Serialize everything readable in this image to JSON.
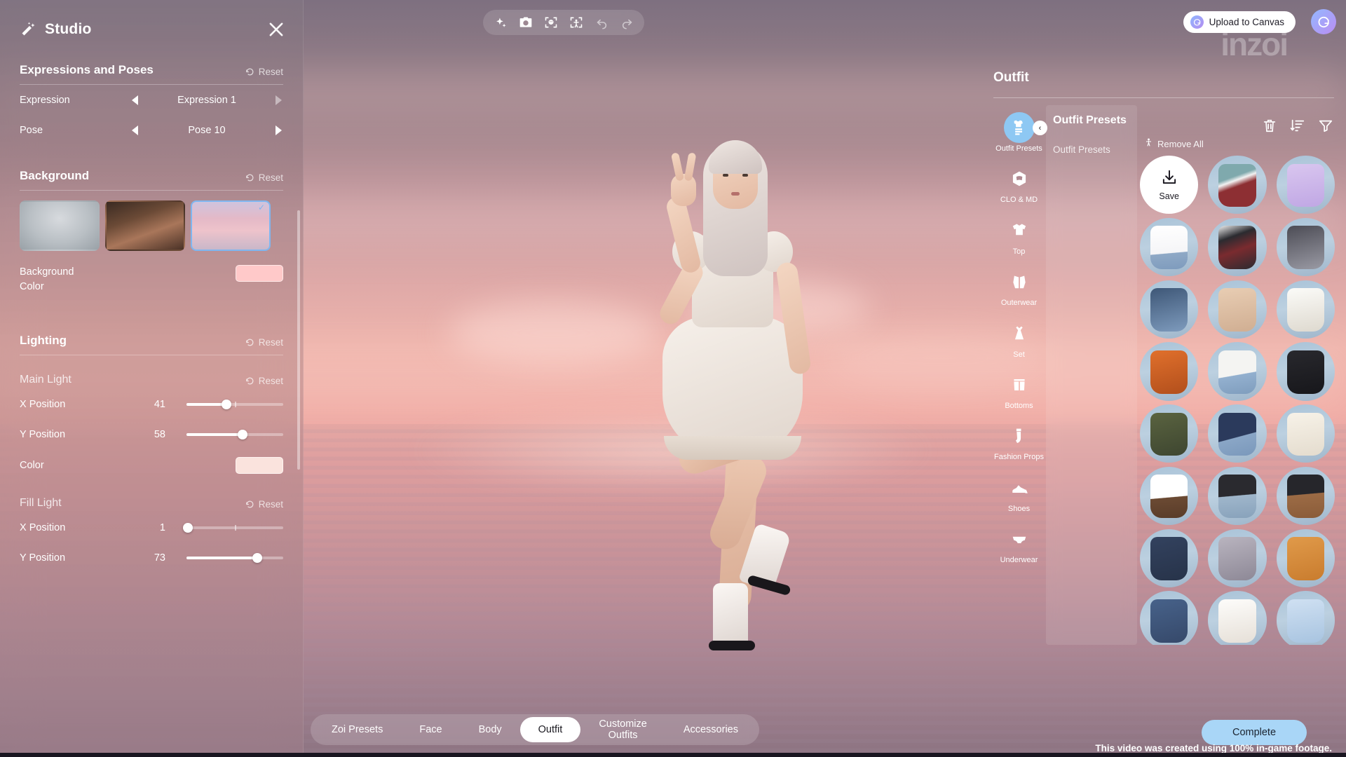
{
  "studio": {
    "title": "Studio",
    "wand_icon": "magic-wand-icon",
    "close_icon": "close-icon",
    "sections": {
      "expressions": {
        "title": "Expressions and Poses",
        "reset_label": "Reset",
        "rows": [
          {
            "label": "Expression",
            "value": "Expression 1"
          },
          {
            "label": "Pose",
            "value": "Pose 10"
          }
        ]
      },
      "background": {
        "title": "Background",
        "reset_label": "Reset",
        "thumbnails": [
          {
            "name": "grey-studio-background",
            "selected": false
          },
          {
            "name": "bedroom-background",
            "selected": false
          },
          {
            "name": "pink-sunset-sea-background",
            "selected": true
          }
        ],
        "color_label_line1": "Background",
        "color_label_line2": "Color",
        "color_value": "#ffc9c9"
      },
      "lighting": {
        "title": "Lighting",
        "reset_label": "Reset",
        "groups": [
          {
            "title": "Main Light",
            "reset_label": "Reset",
            "sliders": [
              {
                "label": "X Position",
                "value": 41
              },
              {
                "label": "Y Position",
                "value": 58
              }
            ],
            "color_label": "Color",
            "color_value": "#fae3dd"
          },
          {
            "title": "Fill Light",
            "reset_label": "Reset",
            "sliders": [
              {
                "label": "X Position",
                "value": 1
              },
              {
                "label": "Y Position",
                "value": 73
              }
            ]
          }
        ]
      }
    }
  },
  "toolbar": {
    "buttons": [
      {
        "name": "ai-enhance-icon",
        "label": "AI Enhance",
        "enabled": true
      },
      {
        "name": "camera-icon",
        "label": "Camera",
        "enabled": true
      },
      {
        "name": "face-focus-icon",
        "label": "Face Focus",
        "enabled": true
      },
      {
        "name": "body-focus-icon",
        "label": "Body Focus",
        "enabled": true
      },
      {
        "name": "undo-icon",
        "label": "Undo",
        "enabled": false
      },
      {
        "name": "redo-icon",
        "label": "Redo",
        "enabled": false
      }
    ]
  },
  "topright": {
    "upload_label": "Upload to Canvas",
    "upload_badge_icon": "canvas-logo-icon",
    "profile_icon": "profile-avatar-icon",
    "wordmark": "inzoi"
  },
  "outfit": {
    "title": "Outfit",
    "remove_all_label": "Remove All",
    "remove_all_icon": "person-icon",
    "tools": [
      {
        "name": "delete-icon",
        "label": "Delete"
      },
      {
        "name": "sort-icon",
        "label": "Sort"
      },
      {
        "name": "filter-icon",
        "label": "Filter"
      }
    ],
    "categories": [
      {
        "label": "Outfit\nPresets",
        "icon": "outfit-presets-icon",
        "active": true
      },
      {
        "label": "CLO & MD",
        "icon": "clo-md-icon",
        "active": false
      },
      {
        "label": "Top",
        "icon": "top-shirt-icon",
        "active": false
      },
      {
        "label": "Outerwear",
        "icon": "outerwear-icon",
        "active": false
      },
      {
        "label": "Set",
        "icon": "dress-set-icon",
        "active": false
      },
      {
        "label": "Bottoms",
        "icon": "bottoms-shorts-icon",
        "active": false
      },
      {
        "label": "Fashion\nProps",
        "icon": "sock-props-icon",
        "active": false
      },
      {
        "label": "Shoes",
        "icon": "shoe-icon",
        "active": false
      },
      {
        "label": "Underwear",
        "icon": "underwear-icon",
        "active": false
      }
    ],
    "subpanel": {
      "title": "Outfit Presets",
      "items": [
        "Outfit Presets"
      ]
    },
    "collapse_icon": "chevron-left-icon",
    "save_cell": {
      "label": "Save",
      "icon": "download-icon"
    },
    "presets": [
      {
        "name": "varsity-jacket-red-teal",
        "garment": "linear-gradient(160deg,#7fa9ad 0%,#7fa9ad 32%,#f2f2f2 40%,#8d2f33 52%,#8d2f33 100%)"
      },
      {
        "name": "lilac-tiered-dress",
        "garment": "linear-gradient(170deg,#d9c6ef,#c0a7e4)"
      },
      {
        "name": "white-graphic-tee-jeans",
        "garment": "linear-gradient(175deg,#ffffff 0%,#f5f5f7 62%,#8fa9c6 63%,#7e9bbd 100%)"
      },
      {
        "name": "black-white-baseball-jacket",
        "garment": "linear-gradient(160deg,#f1f1f1 0%,#2b2b30 28%,#7a2b2f 55%,#2b2b30 100%)"
      },
      {
        "name": "grey-cardigan-crop",
        "garment": "linear-gradient(165deg,#4c4c55,#9a9aa4)"
      },
      {
        "name": "denim-jacket-white-top",
        "garment": "linear-gradient(165deg,#3e5777,#7e9bbd)"
      },
      {
        "name": "beige-knit-dress",
        "garment": "linear-gradient(170deg,#e8cdb3,#d0ae92)"
      },
      {
        "name": "white-collared-cardigan",
        "garment": "linear-gradient(170deg,#fbfbf8,#ded9cf)"
      },
      {
        "name": "orange-utility-jacket",
        "garment": "linear-gradient(165deg,#e0702c,#b24f1c)"
      },
      {
        "name": "white-blazer-denim",
        "garment": "linear-gradient(170deg,#f4f4f2 0%,#f4f4f2 55%,#93b0cf 56%,#7f9dbd 100%)"
      },
      {
        "name": "black-button-shirt",
        "garment": "linear-gradient(170deg,#28282d,#17171b)"
      },
      {
        "name": "green-military-jacket",
        "garment": "linear-gradient(165deg,#5a6340,#3e4630)"
      },
      {
        "name": "navy-varsity-denim",
        "garment": "linear-gradient(165deg,#2b3a5c 0%,#2b3a5c 55%,#8aa6c6 56%,#7a98bb 100%)"
      },
      {
        "name": "cream-sweatshirt",
        "garment": "linear-gradient(170deg,#f7f2e8,#e4dcce)"
      },
      {
        "name": "white-tee-brown-skirt",
        "garment": "linear-gradient(175deg,#ffffff 0%,#ffffff 52%,#6b4a33 53%,#593c29 100%)"
      },
      {
        "name": "black-crop-denim-shorts",
        "garment": "linear-gradient(175deg,#2a2a2f 0%,#2a2a2f 48%,#9fb6cb 49%,#88a2bb 100%)"
      },
      {
        "name": "black-top-brown-pants",
        "garment": "linear-gradient(175deg,#26262b 0%,#26262b 45%,#9c6b45 46%,#8a5c39 100%)"
      },
      {
        "name": "navy-blazer-white-shirt",
        "garment": "linear-gradient(165deg,#33425f,#273349)"
      },
      {
        "name": "grey-hoodie-layered",
        "garment": "linear-gradient(165deg,#b9b4bf,#8d8896)"
      },
      {
        "name": "orange-bomber-jacket",
        "garment": "linear-gradient(165deg,#e09a4a,#c97c2e)"
      },
      {
        "name": "denim-on-denim",
        "garment": "linear-gradient(165deg,#47628a,#36496a)"
      },
      {
        "name": "white-ruffle-blouse",
        "garment": "linear-gradient(170deg,#fdfcfa,#e6e0d8)"
      },
      {
        "name": "light-blue-shirt",
        "garment": "linear-gradient(170deg,#cfe0f2,#a8c4e0)"
      }
    ]
  },
  "tabs": {
    "items": [
      {
        "label": "Zoi Presets",
        "active": false
      },
      {
        "label": "Face",
        "active": false
      },
      {
        "label": "Body",
        "active": false
      },
      {
        "label": "Outfit",
        "active": true
      },
      {
        "label": "Customize\nOutfits",
        "active": false
      },
      {
        "label": "Accessories",
        "active": false
      }
    ]
  },
  "footer": {
    "complete_label": "Complete",
    "note": "This video was created using 100% in-game footage."
  },
  "colors": {
    "accent_blue": "#8ec8f3",
    "complete_blue": "#a9d6f7",
    "selected_border": "#7fb6f0"
  }
}
